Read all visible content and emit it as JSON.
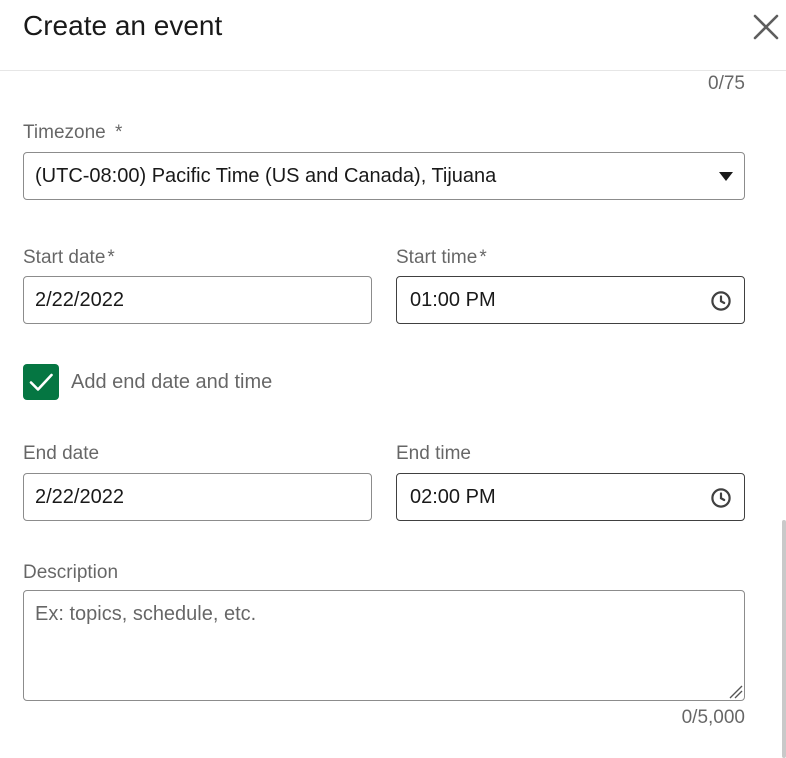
{
  "dialog": {
    "title": "Create an event",
    "close_icon": "close-icon"
  },
  "event_name": {
    "counter": "0/75"
  },
  "timezone": {
    "label": "Timezone",
    "required_mark": "*",
    "selected": "(UTC-08:00) Pacific Time (US and Canada), Tijuana",
    "caret_icon": "caret-down-icon"
  },
  "start": {
    "date_label": "Start date",
    "date_required_mark": "*",
    "date_value": "2/22/2022",
    "time_label": "Start time",
    "time_required_mark": "*",
    "time_value": "01:00 PM",
    "time_icon": "clock-icon"
  },
  "end_toggle": {
    "checked": true,
    "label": "Add end date and time",
    "check_color": "#057642"
  },
  "end": {
    "date_label": "End date",
    "date_value": "2/22/2022",
    "time_label": "End time",
    "time_value": "02:00 PM",
    "time_icon": "clock-icon"
  },
  "description": {
    "label": "Description",
    "placeholder": "Ex: topics, schedule, etc.",
    "value": "",
    "counter": "0/5,000"
  }
}
